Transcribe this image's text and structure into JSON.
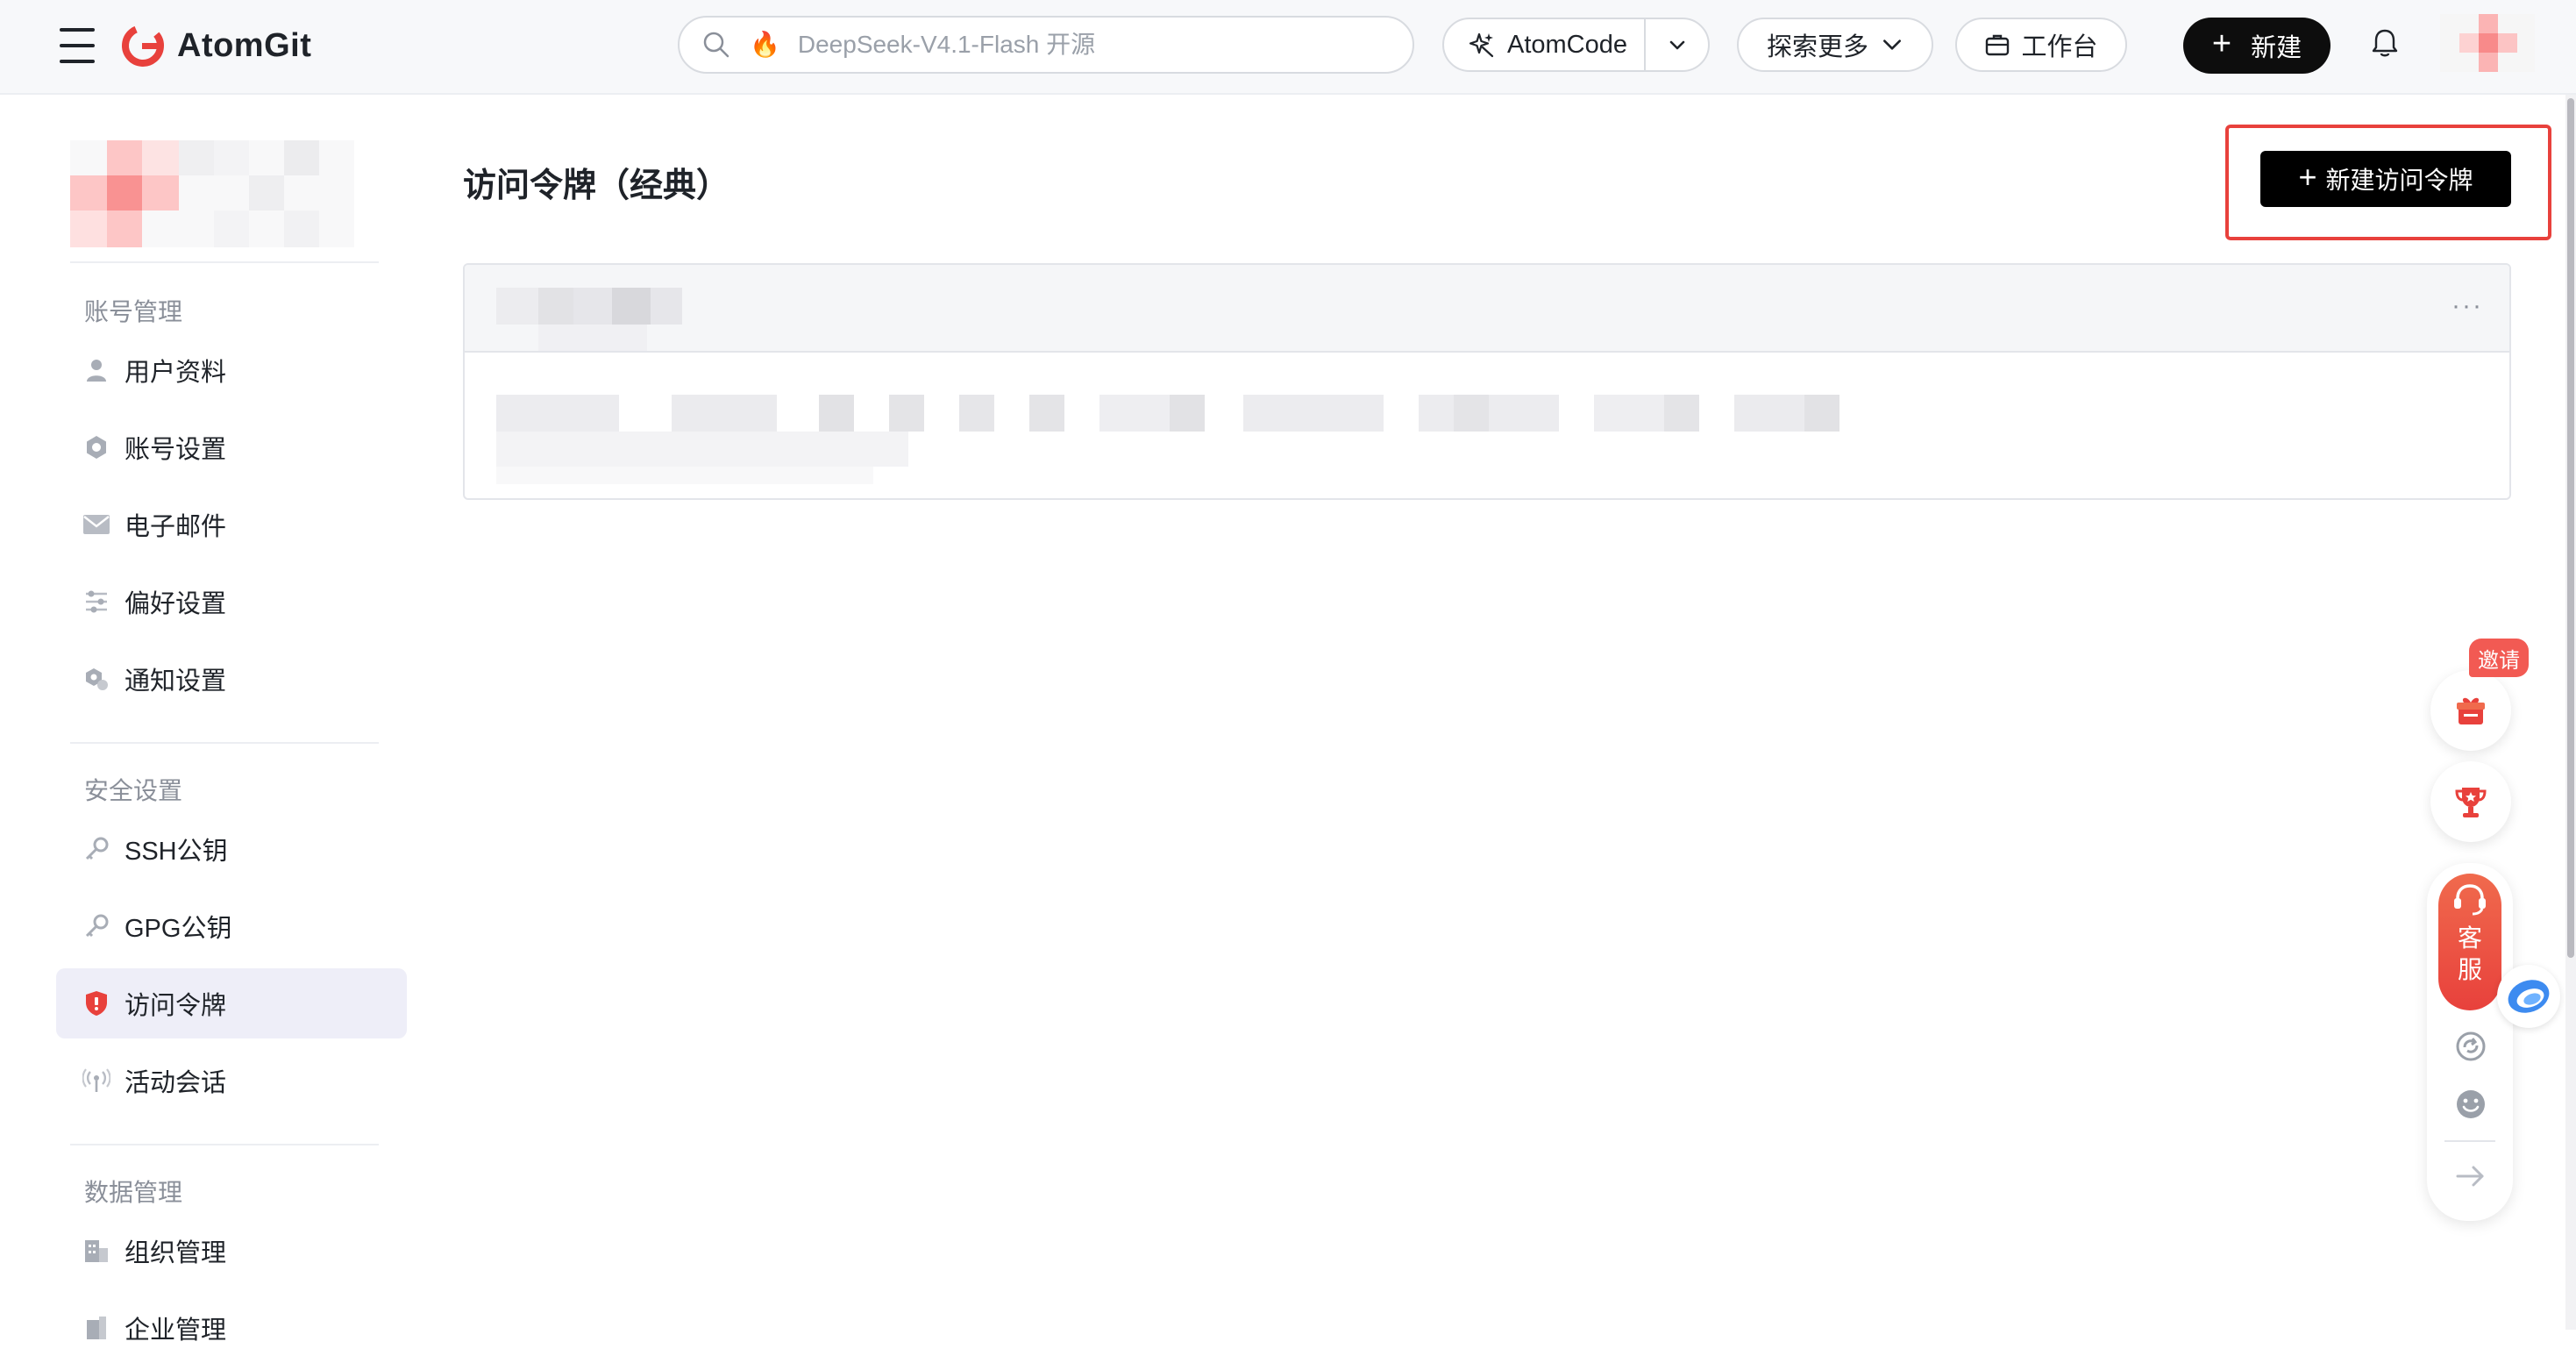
{
  "header": {
    "brand": "AtomGit",
    "search_placeholder": "DeepSeek-V4.1-Flash 开源",
    "atomcode_label": "AtomCode",
    "explore_label": "探索更多",
    "workbench_label": "工作台",
    "new_label": "新建",
    "brand_color": "#e8413c"
  },
  "sidebar": {
    "sections": [
      {
        "title": "账号管理",
        "items": [
          {
            "label": "用户资料",
            "icon": "user-icon"
          },
          {
            "label": "账号设置",
            "icon": "gear-icon"
          },
          {
            "label": "电子邮件",
            "icon": "mail-icon"
          },
          {
            "label": "偏好设置",
            "icon": "sliders-icon"
          },
          {
            "label": "通知设置",
            "icon": "notification-gear-icon"
          }
        ]
      },
      {
        "title": "安全设置",
        "items": [
          {
            "label": "SSH公钥",
            "icon": "key-icon"
          },
          {
            "label": "GPG公钥",
            "icon": "key-icon"
          },
          {
            "label": "访问令牌",
            "icon": "shield-icon",
            "active": true
          },
          {
            "label": "活动会话",
            "icon": "broadcast-icon"
          }
        ]
      },
      {
        "title": "数据管理",
        "items": [
          {
            "label": "组织管理",
            "icon": "building-icon"
          },
          {
            "label": "企业管理",
            "icon": "enterprise-icon"
          }
        ]
      }
    ]
  },
  "main": {
    "title": "访问令牌（经典）",
    "new_token_label": "新建访问令牌",
    "more_label": "···"
  },
  "float_bar": {
    "invite_label": "邀请",
    "service_label": "客服"
  }
}
